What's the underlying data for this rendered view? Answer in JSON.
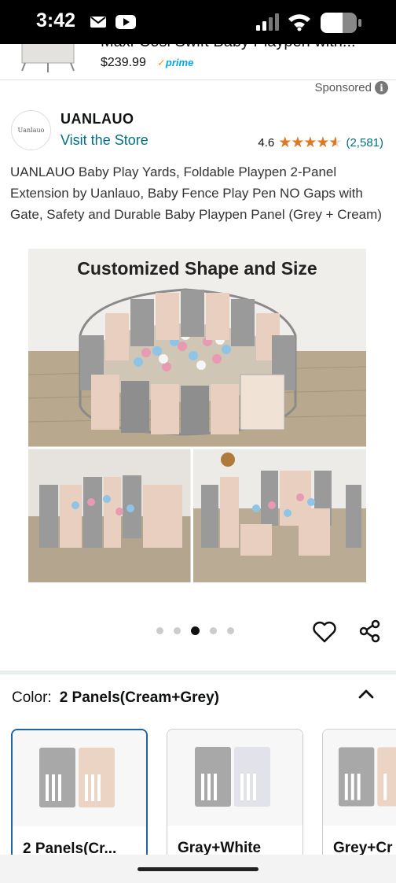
{
  "status_bar": {
    "time": "3:42"
  },
  "prev_product": {
    "title": "Maxi-Cosi Swift Baby Playpen with...",
    "price": "$239.99",
    "prime_label": "prime"
  },
  "ad": {
    "sponsored_label": "Sponsored"
  },
  "brand": {
    "logo_text": "Uanlauo",
    "name": "UANLAUO",
    "visit_store": "Visit the Store",
    "rating": "4.6",
    "stars": 4.6,
    "rating_count": "(2,581)"
  },
  "product": {
    "title": "UANLAUO Baby Play Yards, Foldable Playpen 2-Panel Extension by Uanlauo, Baby Fence Play Pen NO Gaps with Gate, Safety and Durable Baby Playpen Panel (Grey + Cream)",
    "image_caption": "Customized Shape and Size",
    "carousel": {
      "total": 5,
      "active": 3
    }
  },
  "variation": {
    "label": "Color:",
    "value": "2 Panels(Cream+Grey)",
    "swatches": [
      {
        "label": "2 Panels(Cr...",
        "selected": true
      },
      {
        "label": "Gray+White",
        "selected": false
      },
      {
        "label": "Grey+Cr",
        "selected": false
      }
    ]
  },
  "colors": {
    "link": "#007185",
    "star": "#de7921",
    "prime": "#00a8e1",
    "selected_border": "#2162a1"
  }
}
